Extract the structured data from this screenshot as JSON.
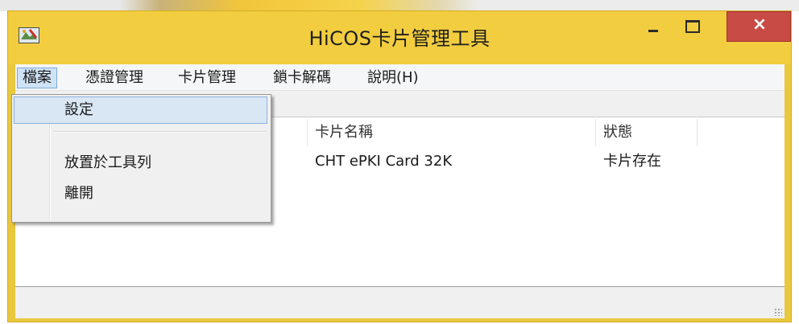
{
  "window": {
    "title": "HiCOS卡片管理工具",
    "minimize_symbol": "–",
    "close_symbol": "×"
  },
  "menubar": {
    "items": [
      {
        "label": "檔案"
      },
      {
        "label": "憑證管理"
      },
      {
        "label": "卡片管理"
      },
      {
        "label": "鎖卡解碼"
      },
      {
        "label": "說明(H)"
      }
    ]
  },
  "file_menu": {
    "items": [
      {
        "label": "設定"
      },
      {
        "label": "放置於工具列"
      },
      {
        "label": "離開"
      }
    ]
  },
  "card_list": {
    "columns": [
      "卡片名稱",
      "狀態"
    ],
    "rows": [
      {
        "name": "CHT ePKI Card 32K",
        "status": "卡片存在"
      }
    ]
  },
  "icons": {
    "app": "app-icon",
    "minimize": "minimize-icon",
    "maximize": "maximize-icon",
    "close": "close-icon",
    "resize_grip": "resize-grip-icon"
  },
  "colors": {
    "titlebar": "#f2cd3f",
    "close_button": "#c84b45",
    "menu_highlight": "#cfe3f7"
  }
}
